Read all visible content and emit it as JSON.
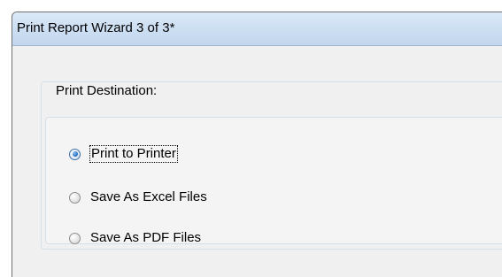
{
  "window": {
    "title": "Print Report Wizard 3 of 3*"
  },
  "print_destination": {
    "label": "Print Destination:",
    "options": [
      {
        "label": "Print to Printer",
        "selected": true,
        "focused": true
      },
      {
        "label": "Save As Excel Files",
        "selected": false,
        "focused": false
      },
      {
        "label": "Save As PDF Files",
        "selected": false,
        "focused": false
      }
    ]
  },
  "colors": {
    "titlebar": "#cfe0f3",
    "dialog_background": "#f0f0f0",
    "radio_accent": "#2f78c9"
  }
}
